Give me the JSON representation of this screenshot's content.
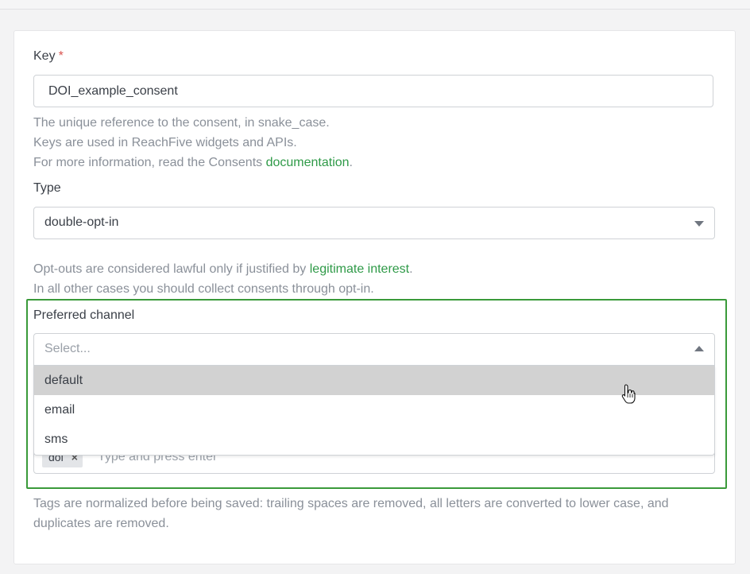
{
  "form": {
    "key": {
      "label": "Key",
      "required_mark": "*",
      "value": "DOI_example_consent",
      "help_line1": "The unique reference to the consent, in snake_case.",
      "help_line2": "Keys are used in ReachFive widgets and APIs.",
      "help_line3_prefix": "For more information, read the Consents ",
      "help_link": "documentation",
      "help_line3_suffix": "."
    },
    "type": {
      "label": "Type",
      "value": "double-opt-in",
      "help_line1_prefix": "Opt-outs are considered lawful only if justified by ",
      "help_link": "legitimate interest",
      "help_line1_suffix": ".",
      "help_line2": "In all other cases you should collect consents through opt-in."
    },
    "preferred_channel": {
      "label": "Preferred channel",
      "placeholder": "Select...",
      "options": [
        "default",
        "email",
        "sms"
      ],
      "highlighted_option": "default"
    },
    "tags": {
      "chip": "doi",
      "chip_remove": "×",
      "placeholder": "Type and press enter",
      "help_line1": "Tags are normalized before being saved: trailing spaces are removed, all letters are converted to lower case, and",
      "help_line2": "duplicates are removed."
    }
  },
  "colors": {
    "link": "#2f9a48",
    "highlight_border": "#3a9a3a",
    "option_hover": "#d2d2d2",
    "required": "#d9534f"
  }
}
